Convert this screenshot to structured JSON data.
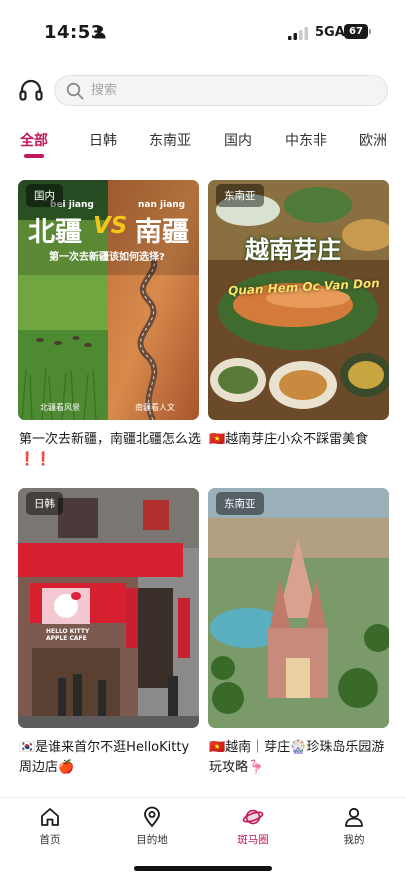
{
  "status_bar": {
    "time": "14:53",
    "network": "5GA",
    "battery": "67"
  },
  "search": {
    "placeholder": "搜索"
  },
  "tabs": [
    {
      "label": "全部",
      "active": true
    },
    {
      "label": "日韩",
      "active": false
    },
    {
      "label": "东南亚",
      "active": false
    },
    {
      "label": "国内",
      "active": false
    },
    {
      "label": "中东非",
      "active": false
    },
    {
      "label": "欧洲",
      "active": false
    }
  ],
  "cards": [
    {
      "tag": "国内",
      "title": "第一次去新疆，南疆北疆怎么选❗❗",
      "image_text": {
        "pinyin_left": "bei  jiang",
        "pinyin_right": "nan  jiang",
        "left": "北疆",
        "vs": "VS",
        "right": "南疆",
        "subtitle": "第一次去新疆该如何选择?",
        "caption_left": "北疆看风景",
        "caption_right": "南疆看人文"
      }
    },
    {
      "tag": "东南亚",
      "title": "🇻🇳越南芽庄小众不踩雷美食",
      "image_text": {
        "headline": "越南芽庄",
        "script": "Quan Hem Oc Van Don"
      }
    },
    {
      "tag": "日韩",
      "title": "🇰🇷是谁来首尔不逛HelloKitty周边店🍎",
      "image_text": {
        "sign": "HELLO KITTY APPLE CAFE"
      }
    },
    {
      "tag": "东南亚",
      "title": "🇻🇳越南｜芽庄🎡珍珠岛乐园游玩攻略🦩",
      "image_text": {}
    }
  ],
  "bottom_nav": [
    {
      "label": "首页",
      "icon": "home-icon",
      "active": false
    },
    {
      "label": "目的地",
      "icon": "location-pin-icon",
      "active": false
    },
    {
      "label": "斑马圈",
      "icon": "planet-icon",
      "active": true
    },
    {
      "label": "我的",
      "icon": "user-icon",
      "active": false
    }
  ],
  "colors": {
    "accent": "#c2185b",
    "text": "#1a1a1a",
    "muted": "#a6a6a6"
  }
}
